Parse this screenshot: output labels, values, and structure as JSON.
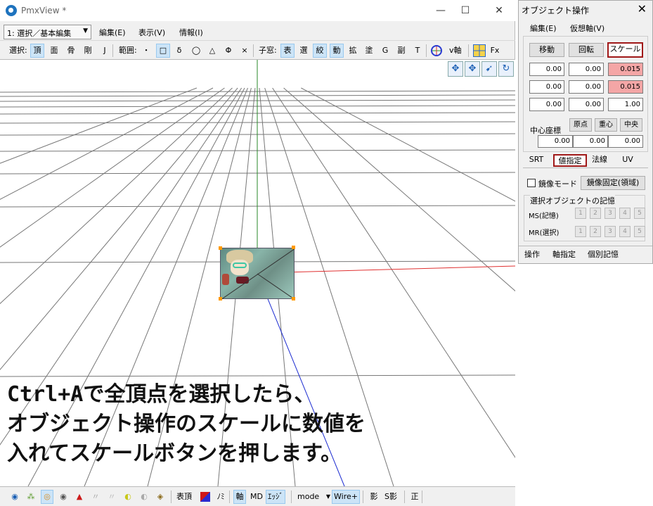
{
  "pmx": {
    "title": "PmxView *",
    "window": {
      "minimize": "—",
      "maximize": "☐",
      "close": "✕"
    },
    "mode_select": "1: 選択／基本編集",
    "menus": [
      "編集(E)",
      "表示(V)",
      "情報(I)"
    ],
    "toolbar1": {
      "select_label": "選択:",
      "select_items": [
        {
          "label": "頂",
          "active": true
        },
        {
          "label": "面",
          "active": false
        },
        {
          "label": "骨",
          "active": false
        },
        {
          "label": "剛",
          "active": false
        },
        {
          "label": "J",
          "active": false
        }
      ],
      "range_label": "範囲:",
      "range_items": [
        {
          "label": "・",
          "active": false
        },
        {
          "label": "□",
          "active": true
        },
        {
          "label": "δ",
          "active": false
        },
        {
          "label": "◯",
          "active": false
        },
        {
          "label": "△",
          "active": false
        },
        {
          "label": "Φ",
          "active": false
        },
        {
          "label": "×",
          "active": false
        }
      ],
      "child_label": "子窓:",
      "child_items": [
        {
          "label": "表",
          "active": true
        },
        {
          "label": "選",
          "active": false
        },
        {
          "label": "絞",
          "active": true
        },
        {
          "label": "動",
          "active": true
        },
        {
          "label": "拡",
          "active": false
        },
        {
          "label": "塗",
          "active": false
        },
        {
          "label": "G",
          "active": false
        },
        {
          "label": "副",
          "active": false
        },
        {
          "label": "T",
          "active": false
        }
      ],
      "vaxis_label": "v軸",
      "fx_label": "Fx"
    },
    "caption": "Ctrl+Aで全頂点を選択したら、\nオブジェクト操作のスケールに数値を\n入れてスケールボタンを押します。",
    "toolbar2": {
      "icons": [
        "◉",
        "⁂",
        "◎",
        "◉",
        "▲",
        "〃",
        "〃",
        "◐",
        "◐",
        "◈"
      ],
      "vertex_label": "表頂",
      "no_label": "ﾉﾐ",
      "axis_label": "軸",
      "md_label": "MD",
      "edge_label": "ｴｯｼﾞ",
      "mode_label": "mode",
      "wire_label": "Wire+",
      "shadow_label": "影",
      "sshadow_label": "S影",
      "correct_label": "正"
    }
  },
  "object_panel": {
    "title": "オブジェクト操作",
    "close": "✕",
    "menu": [
      "編集(E)",
      "仮想軸(V)"
    ],
    "buttons": {
      "move": "移動",
      "rotate": "回転",
      "scale": "スケール"
    },
    "rows": [
      [
        "0.00",
        "0.00",
        "0.015"
      ],
      [
        "0.00",
        "0.00",
        "0.015"
      ],
      [
        "0.00",
        "0.00",
        "1.00"
      ]
    ],
    "center_label": "中心座標",
    "center_buttons": [
      "原点",
      "重心",
      "中央"
    ],
    "center_values": [
      "0.00",
      "0.00",
      "0.00"
    ],
    "tabs": [
      "SRT",
      "値指定",
      "法線",
      "UV"
    ],
    "mirror_mode": "鏡像モード",
    "mirror_fixed": "鏡像固定(領域)",
    "memory_group": "選択オブジェクトの記憶",
    "ms_label": "MS(記憶)",
    "mr_label": "MR(選択)",
    "slots": [
      "1",
      "2",
      "3",
      "4",
      "5"
    ],
    "bottom_tabs": [
      "操作",
      "軸指定",
      "個別記憶"
    ],
    "colors": {
      "highlight_border": "#a01818",
      "pink_field": "#f4a6a6"
    }
  }
}
